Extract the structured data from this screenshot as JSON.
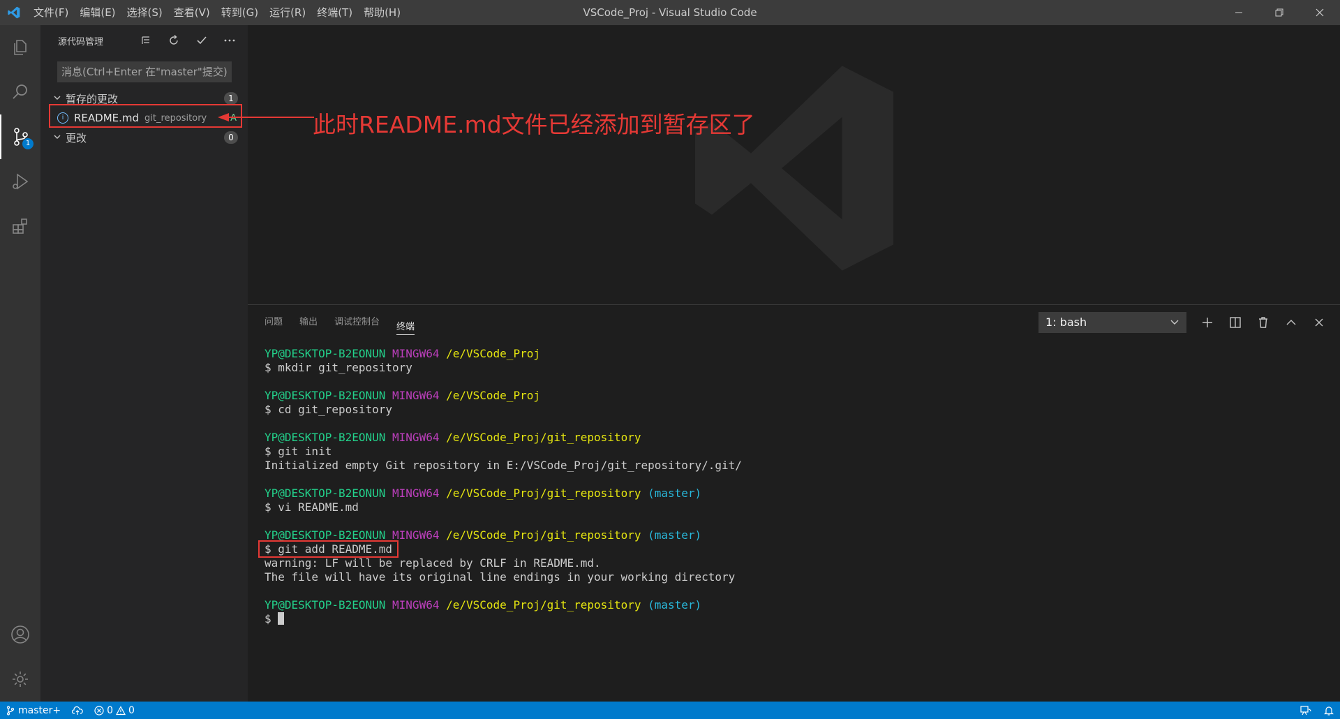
{
  "titlebar": {
    "menu": [
      "文件(F)",
      "编辑(E)",
      "选择(S)",
      "查看(V)",
      "转到(G)",
      "运行(R)",
      "终端(T)",
      "帮助(H)"
    ],
    "window_title": "VSCode_Proj - Visual Studio Code"
  },
  "activitybar": {
    "scm_badge": "1"
  },
  "sidebar": {
    "title": "源代码管理",
    "commit_placeholder": "消息(Ctrl+Enter 在\"master\"提交)",
    "staged": {
      "label": "暂存的更改",
      "count": "1"
    },
    "staged_file": {
      "name": "README.md",
      "dir": "git_repository",
      "status": "A"
    },
    "changes": {
      "label": "更改",
      "count": "0"
    }
  },
  "annotation": {
    "text": "此时README.md文件已经添加到暂存区了",
    "color": "#e53935"
  },
  "panel": {
    "tabs": [
      "问题",
      "输出",
      "调试控制台",
      "终端"
    ],
    "active_tab": "终端",
    "terminal_select": "1: bash"
  },
  "terminal": {
    "lines": [
      {
        "user": "YP@DESKTOP-B2EONUN",
        "env": "MINGW64",
        "path": "/e/VSCode_Proj",
        "branch": ""
      },
      {
        "text": "$ mkdir git_repository"
      },
      {
        "blank": true
      },
      {
        "user": "YP@DESKTOP-B2EONUN",
        "env": "MINGW64",
        "path": "/e/VSCode_Proj",
        "branch": ""
      },
      {
        "text": "$ cd git_repository"
      },
      {
        "blank": true
      },
      {
        "user": "YP@DESKTOP-B2EONUN",
        "env": "MINGW64",
        "path": "/e/VSCode_Proj/git_repository",
        "branch": ""
      },
      {
        "text": "$ git init"
      },
      {
        "text": "Initialized empty Git repository in E:/VSCode_Proj/git_repository/.git/"
      },
      {
        "blank": true
      },
      {
        "user": "YP@DESKTOP-B2EONUN",
        "env": "MINGW64",
        "path": "/e/VSCode_Proj/git_repository",
        "branch": "(master)"
      },
      {
        "text": "$ vi README.md"
      },
      {
        "blank": true
      },
      {
        "user": "YP@DESKTOP-B2EONUN",
        "env": "MINGW64",
        "path": "/e/VSCode_Proj/git_repository",
        "branch": "(master)"
      },
      {
        "text": "$ git add README.md",
        "boxed": true
      },
      {
        "text": "warning: LF will be replaced by CRLF in README.md."
      },
      {
        "text": "The file will have its original line endings in your working directory"
      },
      {
        "blank": true
      },
      {
        "user": "YP@DESKTOP-B2EONUN",
        "env": "MINGW64",
        "path": "/e/VSCode_Proj/git_repository",
        "branch": "(master)"
      },
      {
        "text": "$ ",
        "cursor": true
      }
    ]
  },
  "statusbar": {
    "branch": "master+",
    "errors": "0",
    "warnings": "0"
  },
  "colors": {
    "accent": "#007acc",
    "prompt_user": "#23d18b",
    "prompt_env": "#bc3fbc",
    "prompt_path": "#e5e510",
    "prompt_branch": "#29b8db"
  }
}
